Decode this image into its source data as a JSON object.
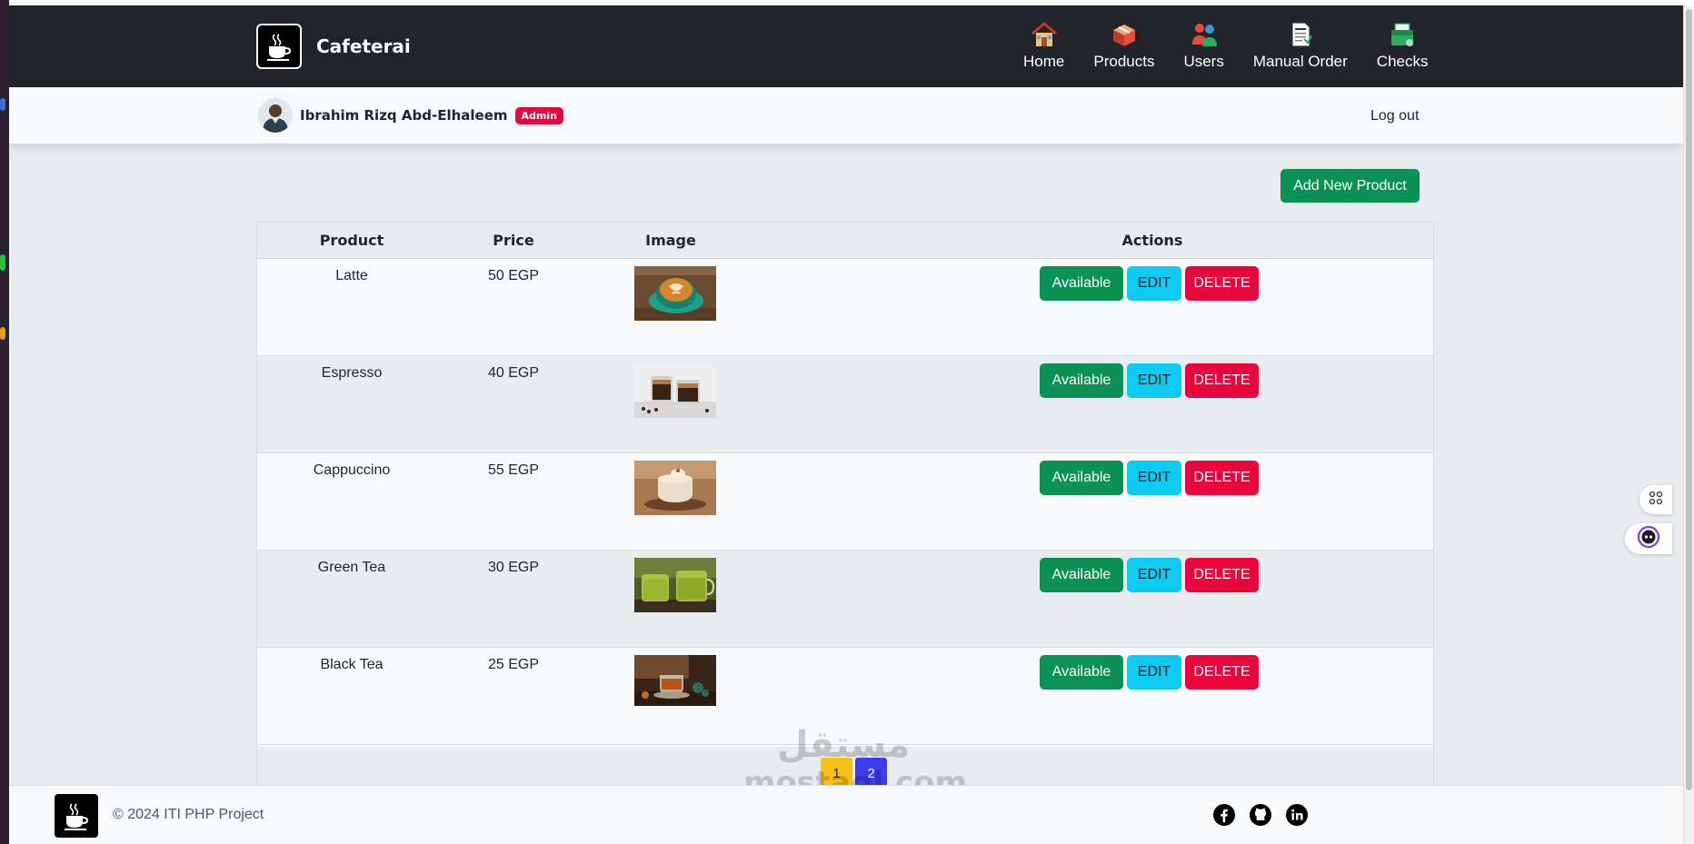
{
  "app": {
    "brand_name": "Cafeterai"
  },
  "nav": {
    "items": [
      {
        "label": "Home",
        "icon": "home-icon"
      },
      {
        "label": "Products",
        "icon": "box-icon"
      },
      {
        "label": "Users",
        "icon": "users-icon"
      },
      {
        "label": "Manual Order",
        "icon": "document-icon"
      },
      {
        "label": "Checks",
        "icon": "checks-icon"
      }
    ]
  },
  "user": {
    "name": "Ibrahim Rizq Abd-Elhaleem",
    "role_badge": "Admin",
    "logout_label": "Log out"
  },
  "products_page": {
    "add_button_label": "Add New Product",
    "columns": [
      "Product",
      "Price",
      "Image",
      "Actions"
    ],
    "rows": [
      {
        "name": "Latte",
        "price": "50 EGP",
        "image_desc": "latte-image",
        "available_label": "Available",
        "edit_label": "EDIT",
        "delete_label": "DELETE"
      },
      {
        "name": "Espresso",
        "price": "40 EGP",
        "image_desc": "espresso-image",
        "available_label": "Available",
        "edit_label": "EDIT",
        "delete_label": "DELETE"
      },
      {
        "name": "Cappuccino",
        "price": "55 EGP",
        "image_desc": "cappuccino-image",
        "available_label": "Available",
        "edit_label": "EDIT",
        "delete_label": "DELETE"
      },
      {
        "name": "Green Tea",
        "price": "30 EGP",
        "image_desc": "green-tea-image",
        "available_label": "Available",
        "edit_label": "EDIT",
        "delete_label": "DELETE"
      },
      {
        "name": "Black Tea",
        "price": "25 EGP",
        "image_desc": "black-tea-image",
        "available_label": "Available",
        "edit_label": "EDIT",
        "delete_label": "DELETE"
      }
    ],
    "pagination": [
      "1",
      "2"
    ],
    "current_page": "1"
  },
  "footer": {
    "copyright": "© 2024 ITI PHP Project",
    "socials": [
      "facebook-icon",
      "github-icon",
      "linkedin-icon"
    ]
  },
  "watermark": {
    "arabic": "مستقل",
    "latin": "mostaql.com"
  },
  "colors": {
    "navbar": "#212529",
    "success": "#0c9154",
    "info": "#0dcaf0",
    "danger": "#e8063c",
    "page_current": "#f6c016",
    "page_other": "#3d3cf0"
  }
}
